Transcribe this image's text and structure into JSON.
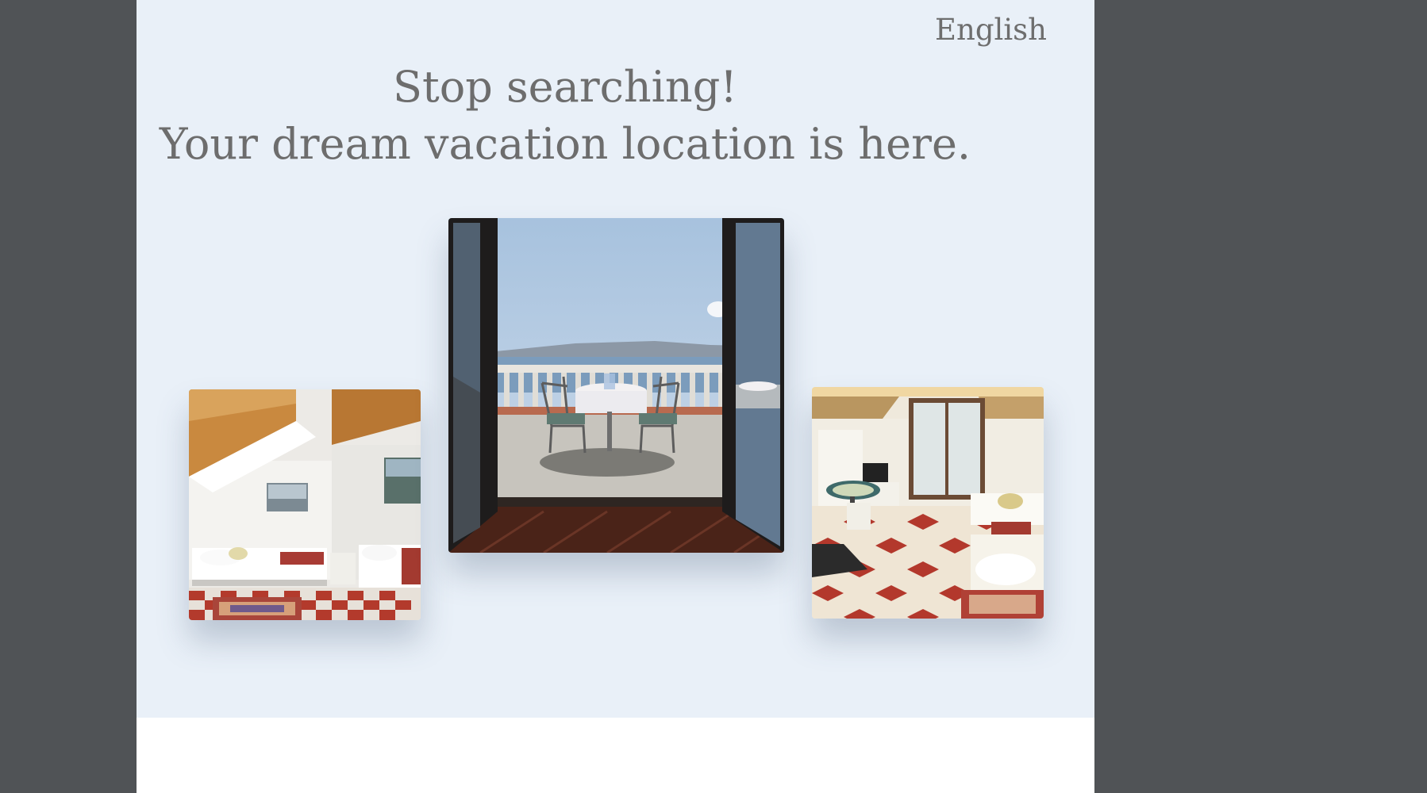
{
  "header": {
    "language_label": "English"
  },
  "hero": {
    "headline_line1": "Stop searching!",
    "headline_line2": "Your dream vacation location is here."
  },
  "colors": {
    "page_background": "#505356",
    "hero_background": "#e9f0f8",
    "text": "#6d6d6d"
  },
  "gallery": {
    "images": [
      {
        "name": "bedroom-photo",
        "description_icon": "attic-bedroom-image"
      },
      {
        "name": "balcony-photo",
        "description_icon": "sea-view-balcony-image"
      },
      {
        "name": "living-room-photo",
        "description_icon": "studio-room-image"
      }
    ]
  }
}
